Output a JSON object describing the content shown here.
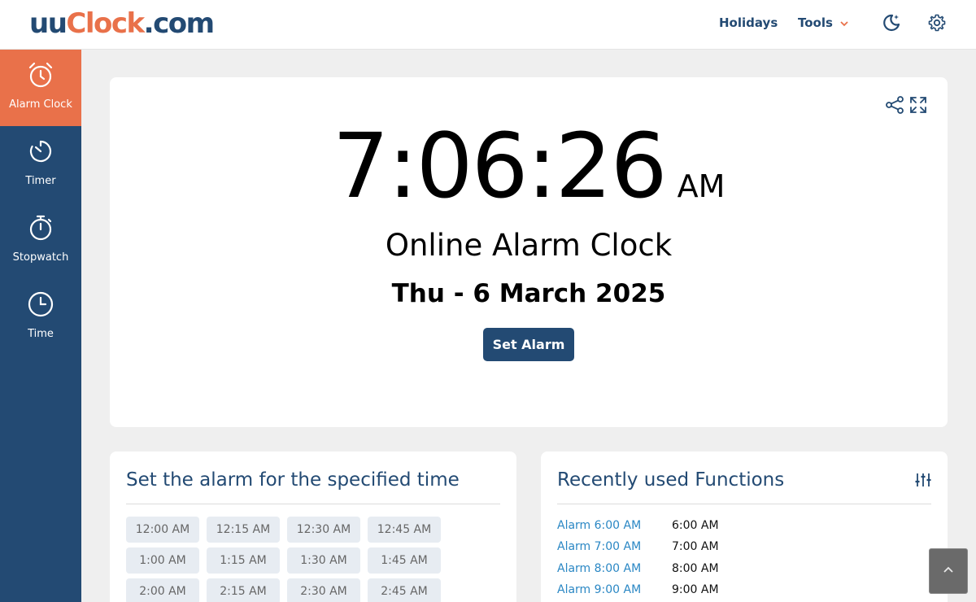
{
  "header": {
    "logo_part1": "uu",
    "logo_part2": "Clock",
    "logo_part3": ".com",
    "nav_holidays": "Holidays",
    "nav_tools": "Tools"
  },
  "sidebar": {
    "items": [
      {
        "label": "Alarm Clock",
        "icon": "alarm-clock-icon",
        "active": true
      },
      {
        "label": "Timer",
        "icon": "timer-icon"
      },
      {
        "label": "Stopwatch",
        "icon": "stopwatch-icon"
      },
      {
        "label": "Time",
        "icon": "clock-icon"
      }
    ]
  },
  "clock": {
    "time": "7:06:26",
    "ampm": "AM",
    "title": "Online Alarm Clock",
    "date": "Thu - 6 March 2025",
    "set_alarm_label": "Set Alarm"
  },
  "alarm_presets": {
    "title": "Set the alarm for the specified time",
    "times": [
      "12:00 AM",
      "12:15 AM",
      "12:30 AM",
      "12:45 AM",
      "1:00 AM",
      "1:15 AM",
      "1:30 AM",
      "1:45 AM",
      "2:00 AM",
      "2:15 AM",
      "2:30 AM",
      "2:45 AM"
    ]
  },
  "recent": {
    "title": "Recently used Functions",
    "rows": [
      {
        "link": "Alarm 6:00 AM",
        "value": "6:00 AM"
      },
      {
        "link": "Alarm 7:00 AM",
        "value": "7:00 AM"
      },
      {
        "link": "Alarm 8:00 AM",
        "value": "8:00 AM"
      },
      {
        "link": "Alarm 9:00 AM",
        "value": "9:00 AM"
      }
    ]
  },
  "colors": {
    "brand_blue": "#234a73",
    "brand_orange": "#e9714a",
    "link_blue": "#2a87c4"
  }
}
